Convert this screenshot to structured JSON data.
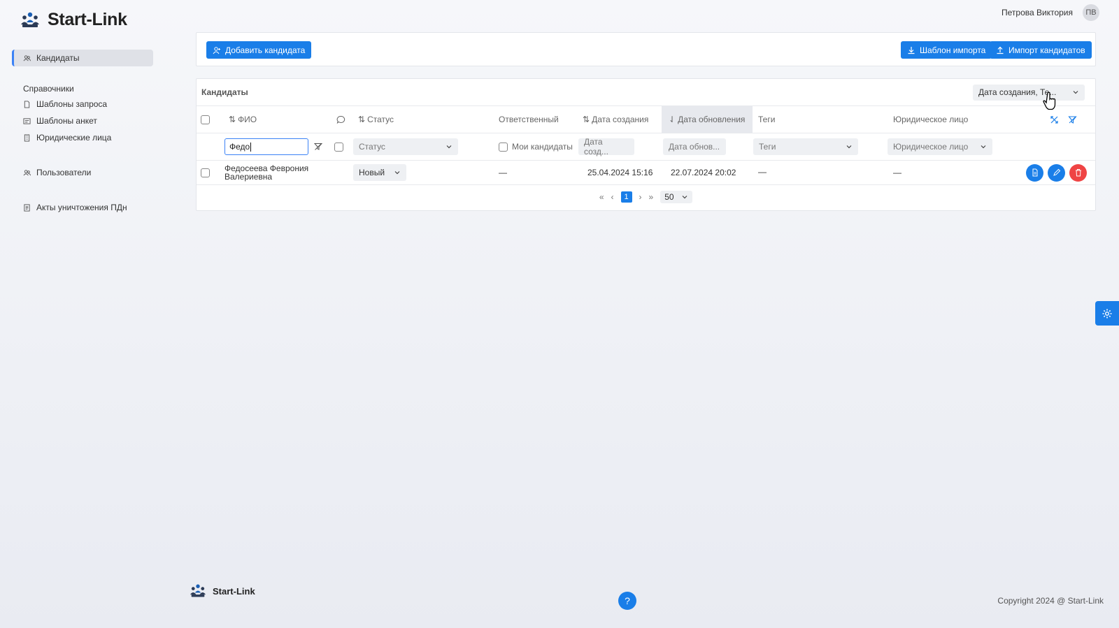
{
  "app": {
    "name": "Start-Link"
  },
  "user": {
    "name": "Петрова Виктория",
    "initials": "ПВ"
  },
  "sidebar": {
    "items": [
      {
        "label": "Кандидаты"
      },
      {
        "label": "Справочники"
      },
      {
        "label": "Шаблоны запроса"
      },
      {
        "label": "Шаблоны анкет"
      },
      {
        "label": "Юридические лица"
      },
      {
        "label": "Пользователи"
      },
      {
        "label": "Акты уничтожения ПДн"
      }
    ]
  },
  "toolbar": {
    "add_candidate": "Добавить кандидата",
    "import_template": "Шаблон импорта",
    "import_candidates": "Импорт кандидатов"
  },
  "table": {
    "title": "Кандидаты",
    "sort_select": "Дата создания, Те...",
    "headers": {
      "fio": "ФИО",
      "status": "Статус",
      "responsible": "Ответственный",
      "created": "Дата создания",
      "updated": "Дата обновления",
      "tags": "Теги",
      "legal": "Юридическое лицо"
    },
    "filters": {
      "fio_value": "Федо",
      "status_placeholder": "Статус",
      "my_candidates": "Мои кандидаты",
      "created_placeholder": "Дата созд...",
      "updated_placeholder": "Дата обнов...",
      "tags_placeholder": "Теги",
      "legal_placeholder": "Юридическое лицо"
    },
    "rows": [
      {
        "fio_line1": "Федосеева Феврония",
        "fio_line2": "Валериевна",
        "status": "Новый",
        "responsible": "—",
        "created": "25.04.2024 15:16",
        "updated": "22.07.2024 20:02",
        "tags": "—",
        "legal": "—"
      }
    ],
    "pagination": {
      "current_page": "1",
      "per_page": "50"
    }
  },
  "footer": {
    "copyright": "Copyright 2024 @ Start-Link",
    "help": "?"
  }
}
